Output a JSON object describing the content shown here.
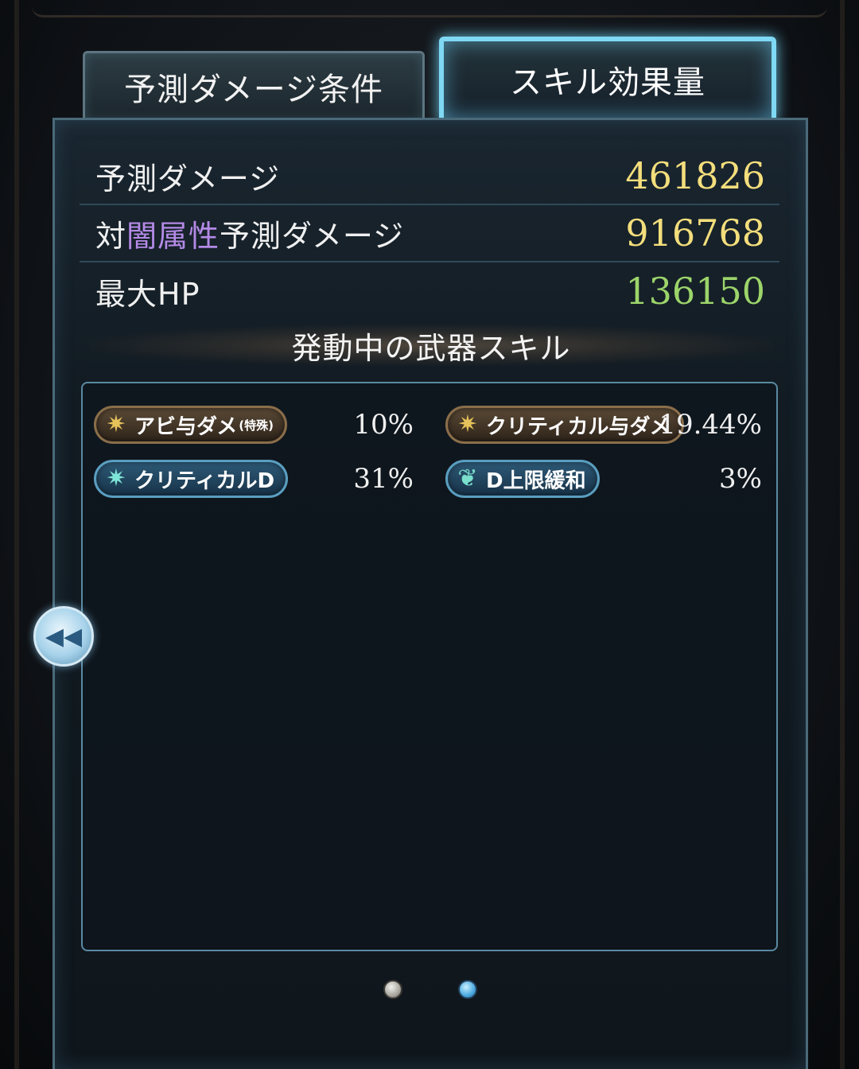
{
  "tabs": [
    {
      "label": "予測ダメージ条件",
      "active": false
    },
    {
      "label": "スキル効果量",
      "active": true
    }
  ],
  "stats": {
    "predicted_damage": {
      "label": "予測ダメージ",
      "value": "461826"
    },
    "element_damage": {
      "label_prefix": "対",
      "label_element": "闇属性",
      "label_suffix": "予測ダメージ",
      "value": "916768"
    },
    "max_hp": {
      "label": "最大HP",
      "value": "136150"
    }
  },
  "section_title": "発動中の武器スキル",
  "skills": [
    {
      "label": "アビ与ダメ",
      "sub": "(特殊)",
      "value": "10%",
      "icon": "gold-burst-icon",
      "style": "gold"
    },
    {
      "label": "クリティカル与ダメ",
      "value": "19.44%",
      "icon": "gold-burst-icon",
      "style": "gold"
    },
    {
      "label": "クリティカルD",
      "value": "31%",
      "icon": "cyan-burst-icon",
      "style": "blue"
    },
    {
      "label": "D上限緩和",
      "value": "3%",
      "icon": "leaf-icon",
      "style": "blue"
    }
  ],
  "pager": {
    "count": 2,
    "active_index": 1
  },
  "colors": {
    "value_yellow": "#f3de7c",
    "value_green": "#9cd46a",
    "element_purple": "#b48ae6",
    "active_tab_glow": "#7fd8f4"
  }
}
